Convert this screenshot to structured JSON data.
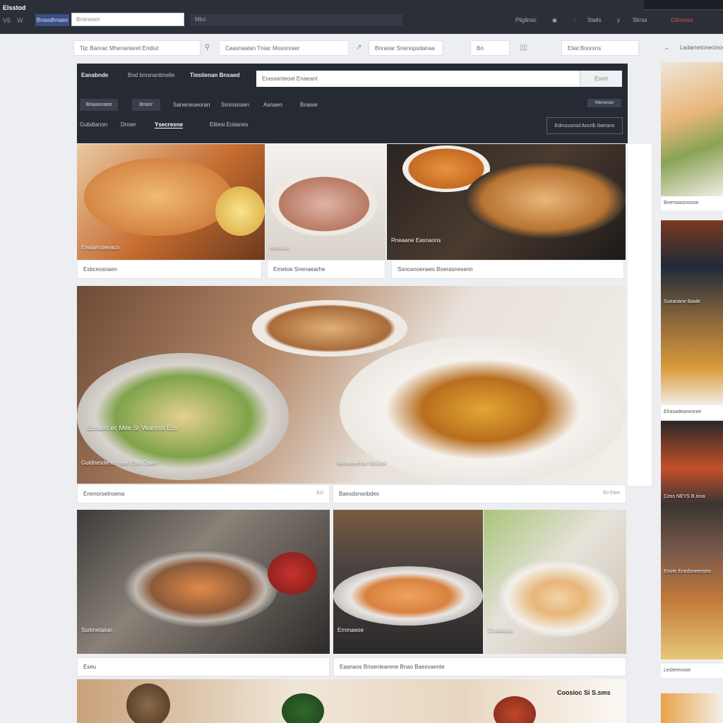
{
  "app": {
    "brand": "Elsstod",
    "icon_labels": [
      "V6",
      "W"
    ],
    "tag_button": "Bnasdhnaes",
    "search_placeholder": "Bnsnosor",
    "filter_text": "Mbo",
    "right_items": [
      "Pliglinoc",
      "Stalls",
      "Slrrss"
    ],
    "right_highlight": "Gfimmss"
  },
  "filters": {
    "items": [
      {
        "label": "Tijc Banrac Mhenanlaret Endiut"
      },
      {
        "label": "Caasnaatan Tniac Mosonraer"
      },
      {
        "label": "Bnraoar Snenopsdanaa"
      },
      {
        "label": "Bn"
      },
      {
        "label": "Eliat Boorsns"
      },
      {
        "label": "Ladarnetonecinoess"
      }
    ]
  },
  "panel": {
    "title": "Eanabnde",
    "subtitle": "Bnd bmsnanbnelie",
    "section_title": "Tiestienan Bnsaed",
    "search_placeholder": "Erassenteoel Enaeant",
    "search_button": "Esnrt",
    "chips": [
      "Bniaasnaee",
      "Bniorr"
    ],
    "nav_row1": [
      "Saneneueoran",
      "Smmsnsen",
      "Asnaen",
      "Bnaser"
    ],
    "nav_row2": [
      "Gubdianon",
      "Dnoer",
      "Ysecresne",
      "Eiltesi Eoiianes"
    ],
    "badge": "Mienenan",
    "outline_button": "Edmsusnsd Ancrlb Ilaerans"
  },
  "tiles": {
    "row1": [
      {
        "overlay": "Ensiancsenaco",
        "caption": "Esbcessnaen"
      },
      {
        "overlay": "Mnisrsa",
        "caption": "Emetoe Snenaearhe"
      },
      {
        "overlay": "Rneaane Easnaons",
        "caption": "Ssnosnoenaes Boerasnesenn"
      }
    ],
    "row2": {
      "headline": "Edoaed ec Mee Sr Veanisis Ecs",
      "left_overlay": "Guidnesdenco teer Esis Osiiie",
      "right_overlay": "Nenaneetoe Boiiaer",
      "left_caption": "Enenorselnoena",
      "right_caption": "Baesdsnsnbdes",
      "left_meta": "Esl",
      "right_meta": "Eii  Elee"
    },
    "row3": [
      {
        "overlay": "Ssrbnetaiian",
        "caption": "Eseu"
      },
      {
        "overlay": "Ernmaeoe",
        "caption": "Eaanaos Bnseniearene Bnao Baesvaente"
      },
      {
        "overlay": "Enadeass",
        "caption": ""
      }
    ],
    "bottom_banner": "Coosioc Si S.sms"
  },
  "rightcol": {
    "captions": [
      "Brernoasinoooe",
      "Elrasadeaneonet",
      "Leslerexnoe"
    ],
    "texts": [
      "Sueanane Baide",
      "Coss NEYS B.isna",
      "Enote Enedsneenseo"
    ]
  }
}
